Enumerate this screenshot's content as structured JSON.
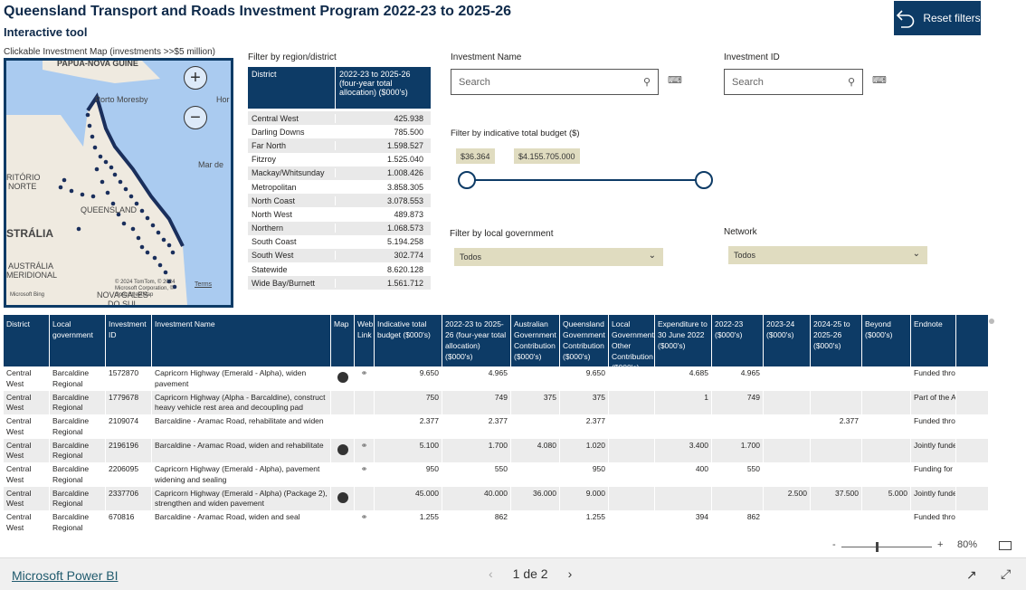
{
  "header": {
    "title": "Queensland Transport and Roads Investment Program 2022-23 to 2025-26",
    "subtitle": "Interactive tool",
    "reset_label": "Reset filters"
  },
  "map": {
    "label": "Clickable Investment Map (investments >>$5 million)",
    "places": [
      "PAPUA-NOVA GUINÉ",
      "Porto Moresby",
      "Hor",
      "Mar de",
      "RITÓRIO",
      "NORTE",
      "QUEENSLAND",
      "STRÁLIA",
      "AUSTRÁLIA",
      "MERIDIONAL",
      "NOVA GALES",
      "DO SUL"
    ],
    "attribution": "© 2024 TomTom, © 2024 Microsoft Corporation, © OpenStreetMap",
    "terms": "Terms",
    "bing": "Microsoft Bing"
  },
  "region_filter": {
    "label": "Filter by region/district",
    "col1": "District",
    "col2": "2022-23 to 2025-26 (four-year total allocation) ($000's)",
    "rows": [
      {
        "district": "Central West",
        "value": "425.938"
      },
      {
        "district": "Darling Downs",
        "value": "785.500"
      },
      {
        "district": "Far North",
        "value": "1.598.527"
      },
      {
        "district": "Fitzroy",
        "value": "1.525.040"
      },
      {
        "district": "Mackay/Whitsunday",
        "value": "1.008.426"
      },
      {
        "district": "Metropolitan",
        "value": "3.858.305"
      },
      {
        "district": "North Coast",
        "value": "3.078.553"
      },
      {
        "district": "North West",
        "value": "489.873"
      },
      {
        "district": "Northern",
        "value": "1.068.573"
      },
      {
        "district": "South Coast",
        "value": "5.194.258"
      },
      {
        "district": "South West",
        "value": "302.774"
      },
      {
        "district": "Statewide",
        "value": "8.620.128"
      },
      {
        "district": "Wide Bay/Burnett",
        "value": "1.561.712"
      }
    ]
  },
  "filters": {
    "investment_name_label": "Investment Name",
    "investment_id_label": "Investment ID",
    "search_placeholder": "Search",
    "budget_label": "Filter by indicative total budget ($)",
    "budget_min": "$36.364",
    "budget_max": "$4.155.705.000",
    "lga_label": "Filter by local government",
    "lga_value": "Todos",
    "network_label": "Network",
    "network_value": "Todos"
  },
  "table": {
    "headers": [
      "District",
      "Local government",
      "Investment ID",
      "Investment Name",
      "Map",
      "Web Link",
      "Indicative total budget ($000's)",
      "2022-23 to 2025-26 (four-year total allocation) ($000's)",
      "Australian Government Contribution ($000's)",
      "Queensland Government Contribution ($000's)",
      "Local Government/ Other Contribution ($000's)",
      "Expenditure to 30 June 2022 ($000's)",
      "2022-23 ($000's)",
      "2023-24 ($000's)",
      "2024-25 to 2025-26 ($000's)",
      "Beyond ($000's)",
      "Endnote"
    ],
    "rows": [
      {
        "district": "Central West",
        "lga": "Barcaldine Regional",
        "id": "1572870",
        "name": "Capricorn Highway (Emerald - Alpha), widen pavement",
        "map": true,
        "link": true,
        "budget": "9.650",
        "alloc": "4.965",
        "aus": "",
        "qld": "9.650",
        "local": "",
        "exp": "4.685",
        "y2223": "4.965",
        "y2324": "",
        "y2426": "",
        "beyond": "",
        "note": "Funded thro"
      },
      {
        "district": "Central West",
        "lga": "Barcaldine Regional",
        "id": "1779678",
        "name": "Capricorn Highway (Alpha - Barcaldine), construct heavy vehicle rest area and decoupling pad",
        "map": false,
        "link": false,
        "budget": "750",
        "alloc": "749",
        "aus": "375",
        "qld": "375",
        "local": "",
        "exp": "1",
        "y2223": "749",
        "y2324": "",
        "y2426": "",
        "beyond": "",
        "note": "Part of the A"
      },
      {
        "district": "Central West",
        "lga": "Barcaldine Regional",
        "id": "2109074",
        "name": "Barcaldine - Aramac Road, rehabilitate and widen",
        "map": false,
        "link": false,
        "budget": "2.377",
        "alloc": "2.377",
        "aus": "",
        "qld": "2.377",
        "local": "",
        "exp": "",
        "y2223": "",
        "y2324": "",
        "y2426": "2.377",
        "beyond": "",
        "note": "Funded thro"
      },
      {
        "district": "Central West",
        "lga": "Barcaldine Regional",
        "id": "2196196",
        "name": "Barcaldine - Aramac Road, widen and rehabilitate",
        "map": true,
        "link": true,
        "budget": "5.100",
        "alloc": "1.700",
        "aus": "4.080",
        "qld": "1.020",
        "local": "",
        "exp": "3.400",
        "y2223": "1.700",
        "y2324": "",
        "y2426": "",
        "beyond": "",
        "note": "Jointly funde"
      },
      {
        "district": "Central West",
        "lga": "Barcaldine Regional",
        "id": "2206095",
        "name": "Capricorn Highway (Emerald - Alpha), pavement widening and sealing",
        "map": false,
        "link": true,
        "budget": "950",
        "alloc": "550",
        "aus": "",
        "qld": "950",
        "local": "",
        "exp": "400",
        "y2223": "550",
        "y2324": "",
        "y2426": "",
        "beyond": "",
        "note": "Funding for"
      },
      {
        "district": "Central West",
        "lga": "Barcaldine Regional",
        "id": "2337706",
        "name": "Capricorn Highway (Emerald - Alpha) (Package 2), strengthen and widen pavement",
        "map": true,
        "link": false,
        "budget": "45.000",
        "alloc": "40.000",
        "aus": "36.000",
        "qld": "9.000",
        "local": "",
        "exp": "",
        "y2223": "",
        "y2324": "2.500",
        "y2426": "37.500",
        "beyond": "5.000",
        "note": "Jointly funde"
      },
      {
        "district": "Central West",
        "lga": "Barcaldine Regional",
        "id": "670816",
        "name": "Barcaldine - Aramac Road, widen and seal",
        "map": false,
        "link": true,
        "budget": "1.255",
        "alloc": "862",
        "aus": "",
        "qld": "1.255",
        "local": "",
        "exp": "394",
        "y2223": "862",
        "y2324": "",
        "y2426": "",
        "beyond": "",
        "note": "Funded thro"
      }
    ]
  },
  "footer": {
    "zoom": "80%",
    "brand": "Microsoft Power BI",
    "page": "1 de 2"
  }
}
